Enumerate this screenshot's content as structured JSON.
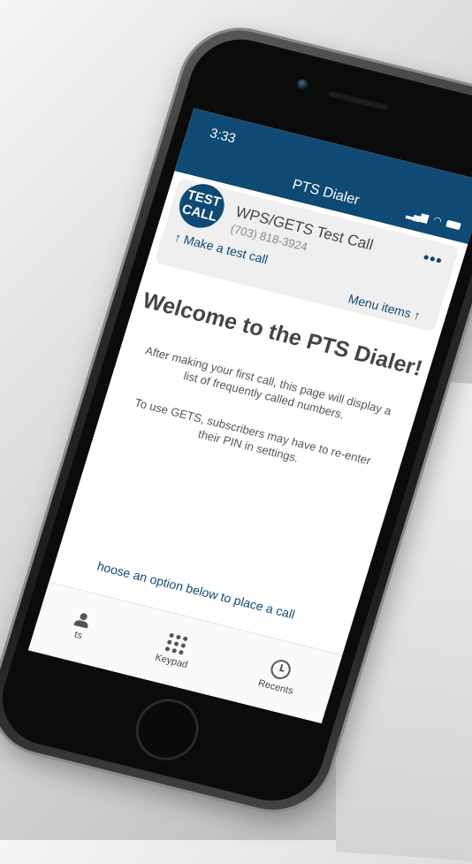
{
  "status_bar": {
    "time": "3:33",
    "title": "PTS Dialer",
    "signal_icon": "signal-icon",
    "wifi_icon": "wifi-icon",
    "battery_icon": "battery-icon"
  },
  "header": {
    "logo_line1": "TEST",
    "logo_line2": "CALL",
    "contact_name": "WPS/GETS Test Call",
    "contact_phone": "(703) 818-3924",
    "more_icon": "more-icon"
  },
  "hints": {
    "make_test_call": "↑ Make a test call",
    "menu_items": "Menu items ↑"
  },
  "main": {
    "welcome": "Welcome to the PTS Dialer!",
    "paragraph1": "After making your first call, this page will display a list of frequently called numbers.",
    "paragraph2": "To use GETS, subscribers may have to  re-enter their PIN in settings."
  },
  "footer": {
    "choose_option": "hoose an option below to place a call"
  },
  "tabs": [
    {
      "label": "ts",
      "icon": "contacts-icon"
    },
    {
      "label": "Keypad",
      "icon": "keypad-icon"
    },
    {
      "label": "Recents",
      "icon": "recents-icon"
    }
  ],
  "colors": {
    "brand": "#0e4a73",
    "text": "#444444"
  }
}
